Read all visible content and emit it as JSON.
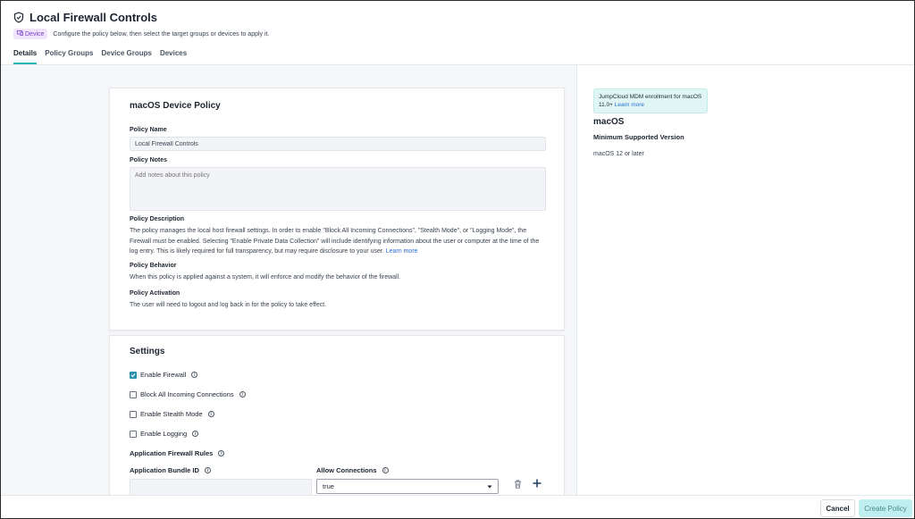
{
  "header": {
    "title": "Local Firewall Controls",
    "badge": "Device",
    "subtitle": "Configure the policy below, then select the target groups or devices to apply it."
  },
  "tabs": [
    {
      "label": "Details",
      "active": true
    },
    {
      "label": "Policy Groups",
      "active": false
    },
    {
      "label": "Device Groups",
      "active": false
    },
    {
      "label": "Devices",
      "active": false
    }
  ],
  "policy": {
    "card_title": "macOS Device Policy",
    "name_label": "Policy Name",
    "name_value": "Local Firewall Controls",
    "notes_label": "Policy Notes",
    "notes_placeholder": "Add notes about this policy",
    "description_label": "Policy Description",
    "description_text": "The policy manages the local host firewall settings. In order to enable \"Block All Incoming Connections\", \"Stealth Mode\", or \"Logging Mode\", the Firewall must be enabled. Selecting \"Enable Private Data Collection\" will include identifying information about the user or computer at the time of the log entry. This is likely required for full transparency, but may require disclosure to your user.",
    "description_link": "Learn more",
    "behavior_label": "Policy Behavior",
    "behavior_text": "When this policy is applied against a system, it will enforce and modify the behavior of the firewall.",
    "activation_label": "Policy Activation",
    "activation_text": "The user will need to logout and log back in for the policy to take effect."
  },
  "settings": {
    "title": "Settings",
    "options": [
      {
        "label": "Enable Firewall",
        "checked": true
      },
      {
        "label": "Block All Incoming Connections",
        "checked": false
      },
      {
        "label": "Enable Stealth Mode",
        "checked": false
      },
      {
        "label": "Enable Logging",
        "checked": false
      }
    ],
    "rules_label": "Application Firewall Rules",
    "bundle_label": "Application Bundle ID",
    "allow_label": "Allow Connections",
    "allow_value": "true"
  },
  "side": {
    "notice_text": "JumpCloud MDM enrollment for macOS 11.0+",
    "notice_link": "Learn more",
    "os": "macOS",
    "min_label": "Minimum Supported Version",
    "min_value": "macOS 12 or later"
  },
  "footer": {
    "cancel": "Cancel",
    "create": "Create Policy"
  },
  "colors": {
    "accent": "#2bb6b6",
    "badge_bg": "#efe4fb",
    "badge_text": "#7b3fd0",
    "notice_bg": "#dff6f4",
    "create_btn": "#bfeeee"
  },
  "icons": {
    "title": "shield-icon",
    "badge": "device-icon",
    "info": "info-icon",
    "delete": "trash-icon",
    "add": "plus-icon",
    "dropdown": "caret-down-icon"
  }
}
